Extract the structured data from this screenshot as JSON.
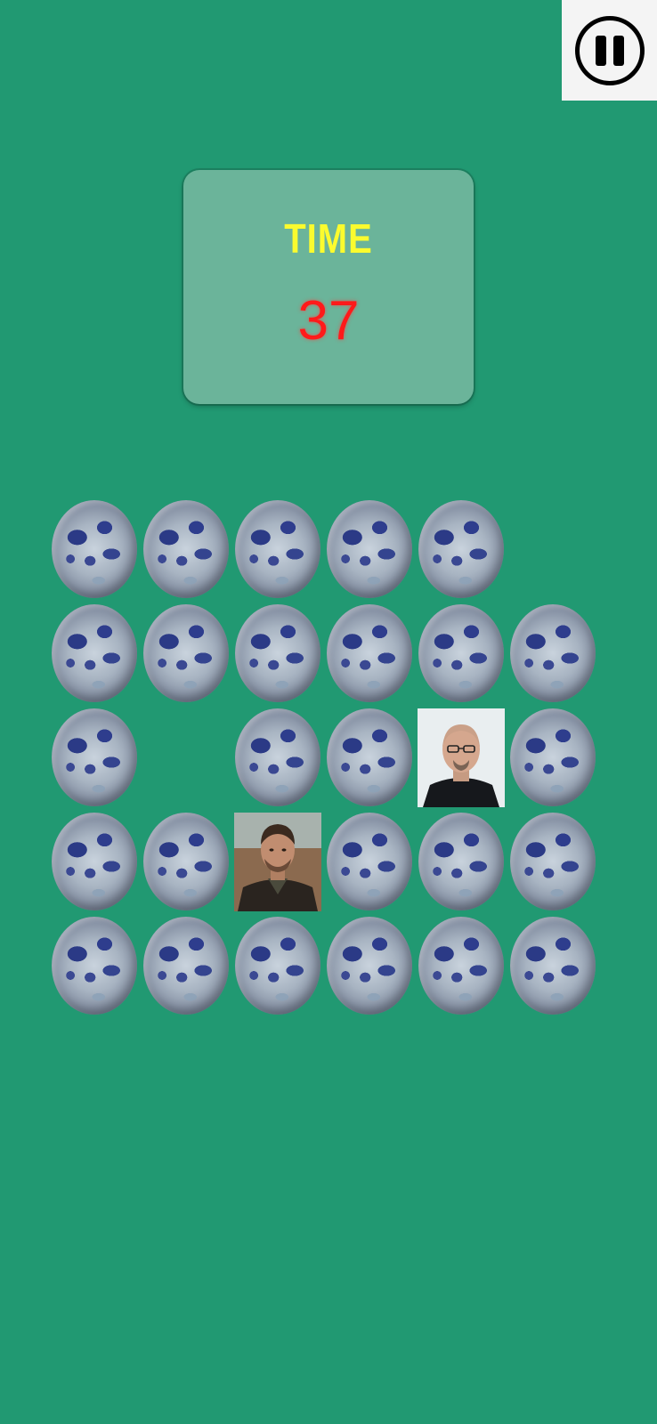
{
  "timer": {
    "label": "TIME",
    "value": "37"
  },
  "pause_button": {
    "icon": "pause-icon"
  },
  "board": {
    "card_back": "moon-icon",
    "rows": [
      [
        "moon",
        "moon",
        "moon",
        "moon",
        "moon",
        "empty"
      ],
      [
        "moon",
        "moon",
        "moon",
        "moon",
        "moon",
        "moon"
      ],
      [
        "moon",
        "empty",
        "moon",
        "moon",
        "face-bald-man",
        "moon"
      ],
      [
        "moon",
        "moon",
        "face-young-man",
        "moon",
        "moon",
        "moon"
      ],
      [
        "moon",
        "moon",
        "moon",
        "moon",
        "moon",
        "moon"
      ]
    ]
  },
  "colors": {
    "background": "#219972",
    "timer_panel": "#6bb49a",
    "timer_label": "#fbfb2e",
    "timer_value": "#ff1a1a"
  }
}
